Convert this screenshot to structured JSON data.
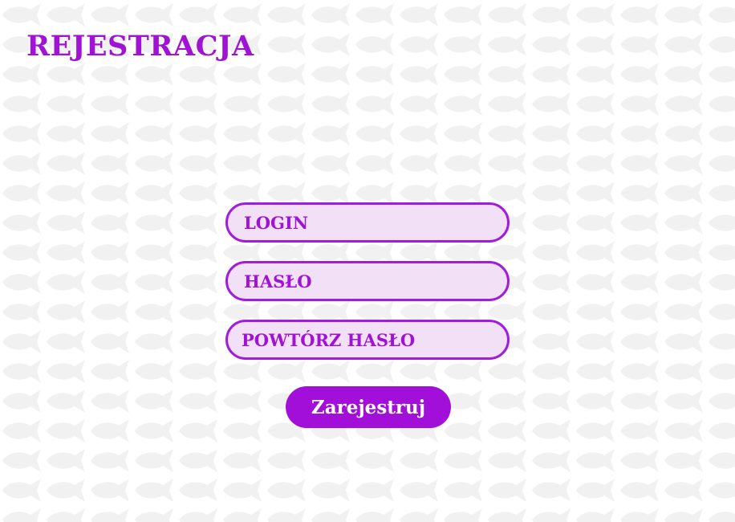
{
  "page": {
    "title": "REJESTRACJA",
    "background_color": "#ffffff",
    "pattern_color": "#f1f1f1",
    "pattern_icon": "fish-icon"
  },
  "form": {
    "login_placeholder": "LOGIN",
    "password_placeholder": "HASŁO",
    "repeat_password_placeholder": "POWTÓRZ HASŁO",
    "submit_label": "Zarejestruj",
    "field_fill_color": "#f1e0f6",
    "field_border_color": "#a21cdb",
    "text_color": "#a012d4",
    "button_color": "#a20fd9",
    "button_text_color": "#ffffff"
  }
}
